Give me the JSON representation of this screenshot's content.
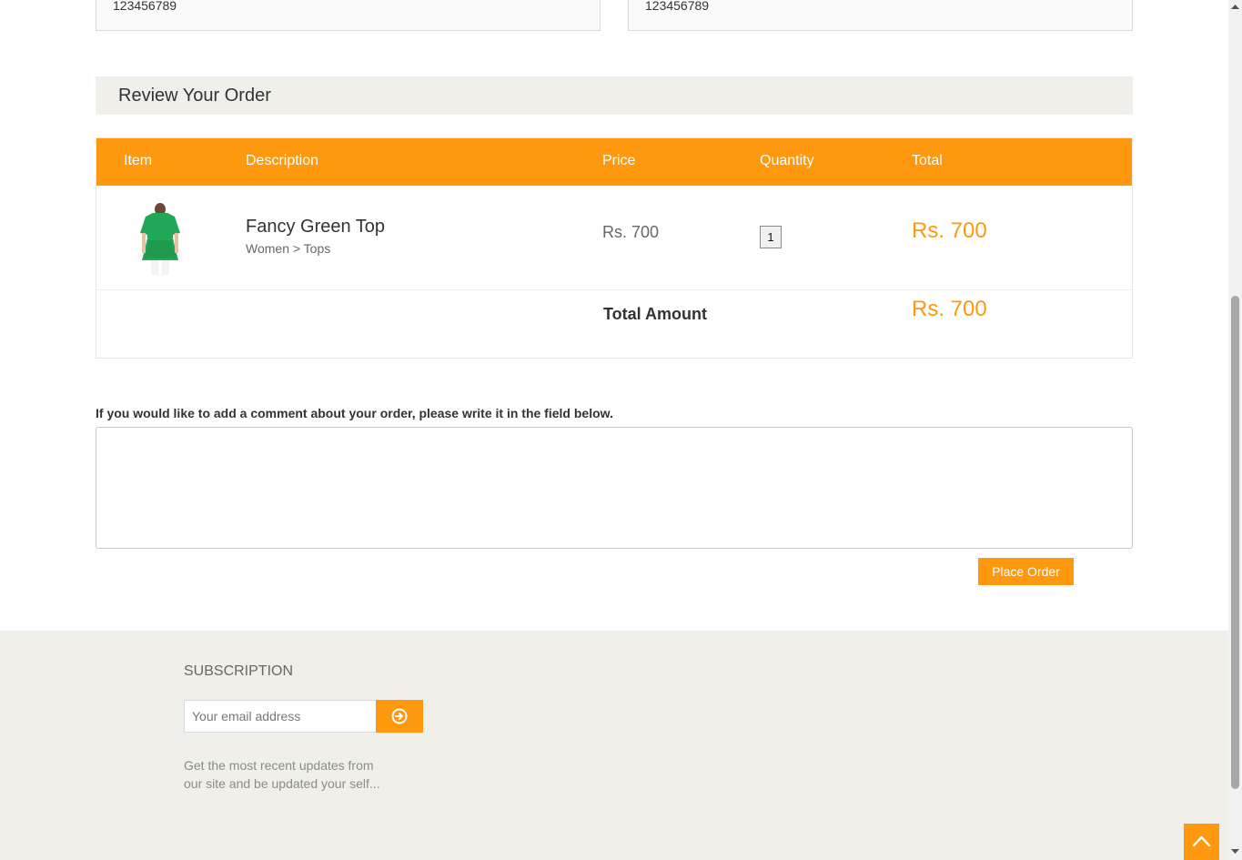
{
  "top_fields": {
    "left_value": "123456789",
    "right_value": "123456789"
  },
  "review": {
    "title": "Review Your Order"
  },
  "table": {
    "headers": {
      "item": "Item",
      "description": "Description",
      "price": "Price",
      "quantity": "Quantity",
      "total": "Total"
    },
    "rows": [
      {
        "name": "Fancy Green Top",
        "category": "Women > Tops",
        "price": "Rs. 700",
        "quantity": "1",
        "total": "Rs. 700",
        "image": "green-top-product-image"
      }
    ],
    "total_label": "Total Amount",
    "total_amount": "Rs. 700"
  },
  "comment": {
    "label": "If you would like to add a comment about your order, please write it in the field below.",
    "value": ""
  },
  "place_order": {
    "label": "Place Order"
  },
  "footer": {
    "subscription_title": "SUBSCRIPTION",
    "email_placeholder": "Your email address",
    "subscribe_icon": "arrow-circle-right-icon",
    "description": "Get the most recent updates from our site and be updated your self..."
  },
  "scroll_top": {
    "icon": "chevron-up-icon"
  },
  "colors": {
    "accent": "#FE980F",
    "panel": "#F0EFE9",
    "text": "#333333",
    "muted": "#696763"
  }
}
